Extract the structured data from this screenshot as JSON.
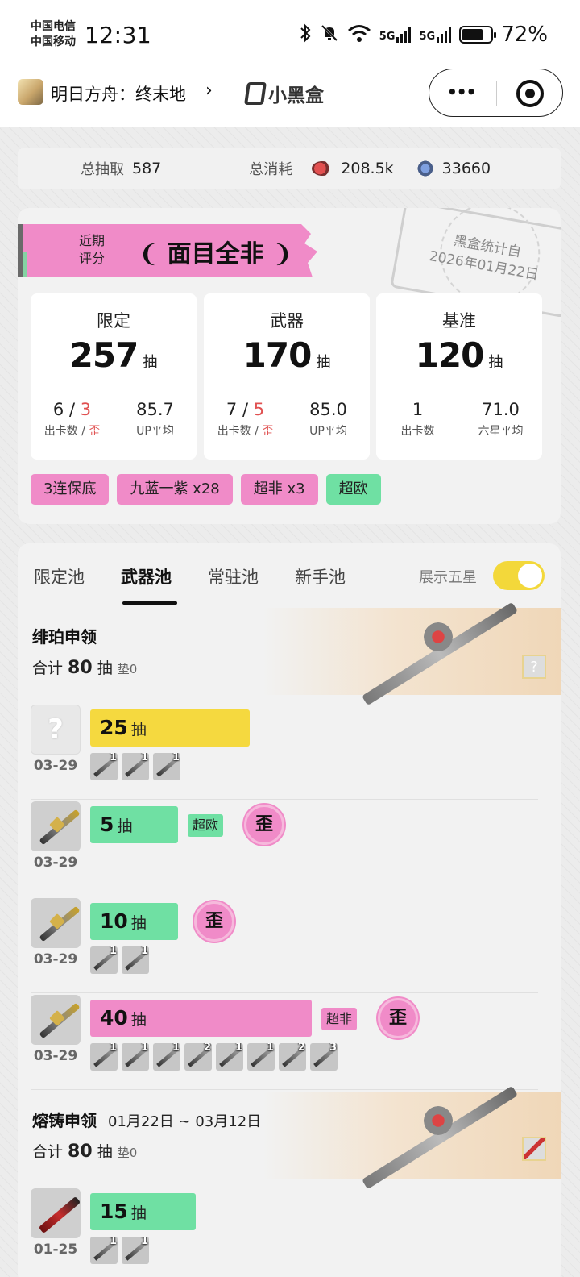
{
  "status_bar": {
    "carrier_1": "中国电信",
    "carrier_2": "中国移动",
    "time": "12:31",
    "battery_text": "72%",
    "battery_level": 0.72,
    "signal_1_label": "5G",
    "signal_2_label": "5G",
    "icons": [
      "bluetooth-icon",
      "mute-icon",
      "wifi-icon",
      "signal-icon",
      "signal-icon",
      "battery-icon"
    ]
  },
  "nav": {
    "app_name": "明日方舟：终末地",
    "chevron": "›",
    "brand": "小黑盒",
    "menu_dots": "•••"
  },
  "summary": {
    "total_pulls_label": "总抽取",
    "total_pulls_value": "587",
    "total_cost_label": "总消耗",
    "cost_a_value": "208.5k",
    "cost_b_value": "33660"
  },
  "score": {
    "label_line1": "近期",
    "label_line2": "评分",
    "value": "面目全非",
    "laurel_left": "❨",
    "laurel_right": "❩",
    "stamp_line1": "黑盒统计自",
    "stamp_line2": "2026年01月22日"
  },
  "stats": [
    {
      "title": "限定",
      "count": "257",
      "unit": "抽",
      "left_value": "6",
      "left_sep": " / ",
      "left_value_red": "3",
      "left_key": "出卡数 / ",
      "left_key_red": "歪",
      "right_value": "85.7",
      "right_key": "UP平均"
    },
    {
      "title": "武器",
      "count": "170",
      "unit": "抽",
      "left_value": "7",
      "left_sep": " / ",
      "left_value_red": "5",
      "left_key": "出卡数 / ",
      "left_key_red": "歪",
      "right_value": "85.0",
      "right_key": "UP平均"
    },
    {
      "title": "基准",
      "count": "120",
      "unit": "抽",
      "left_value": "1",
      "left_sep": "",
      "left_value_red": "",
      "left_key": "出卡数",
      "left_key_red": "",
      "right_value": "71.0",
      "right_key": "六星平均"
    }
  ],
  "tags": [
    {
      "label": "3连保底",
      "color": "pink"
    },
    {
      "label": "九蓝一紫 x28",
      "color": "pink"
    },
    {
      "label": "超非 x3",
      "color": "pink"
    },
    {
      "label": "超欧",
      "color": "green"
    }
  ],
  "tabs": [
    {
      "label": "限定池",
      "active": false
    },
    {
      "label": "武器池",
      "active": true
    },
    {
      "label": "常驻池",
      "active": false
    },
    {
      "label": "新手池",
      "active": false
    }
  ],
  "toggle": {
    "label": "展示五星",
    "on": true
  },
  "pools": [
    {
      "name": "绯珀申领",
      "period": "",
      "total_label": "合计",
      "total_value": "80",
      "total_unit": "抽",
      "pity": "垫0",
      "records": [
        {
          "date": "03-29",
          "count": "25",
          "unit": "抽",
          "fill": 0.62,
          "color": "yellow",
          "badge": "",
          "wai": "",
          "items": [
            "1",
            "1",
            "1"
          ],
          "unknown": true
        },
        {
          "date": "03-29",
          "count": "5",
          "unit": "抽",
          "fill": 0.34,
          "color": "green",
          "badge": "超欧",
          "badge_color": "green",
          "wai": "歪",
          "items": [],
          "unknown": false
        },
        {
          "date": "03-29",
          "count": "10",
          "unit": "抽",
          "fill": 0.34,
          "color": "green",
          "badge": "",
          "wai": "歪",
          "items": [
            "1",
            "1"
          ],
          "unknown": false
        },
        {
          "date": "03-29",
          "count": "40",
          "unit": "抽",
          "fill": 0.86,
          "color": "pink",
          "badge": "超非",
          "badge_color": "pink",
          "wai": "歪",
          "items": [
            "1",
            "1",
            "1",
            "2",
            "1",
            "1",
            "2",
            "3"
          ],
          "unknown": false
        }
      ]
    },
    {
      "name": "熔铸申领",
      "period": "01月22日 ~ 03月12日",
      "total_label": "合计",
      "total_value": "80",
      "total_unit": "抽",
      "pity": "垫0",
      "records": [
        {
          "date": "01-25",
          "count": "15",
          "unit": "抽",
          "fill": 0.41,
          "color": "green",
          "badge": "",
          "wai": "",
          "items": [
            "1",
            "1"
          ],
          "unknown": false
        }
      ]
    }
  ]
}
